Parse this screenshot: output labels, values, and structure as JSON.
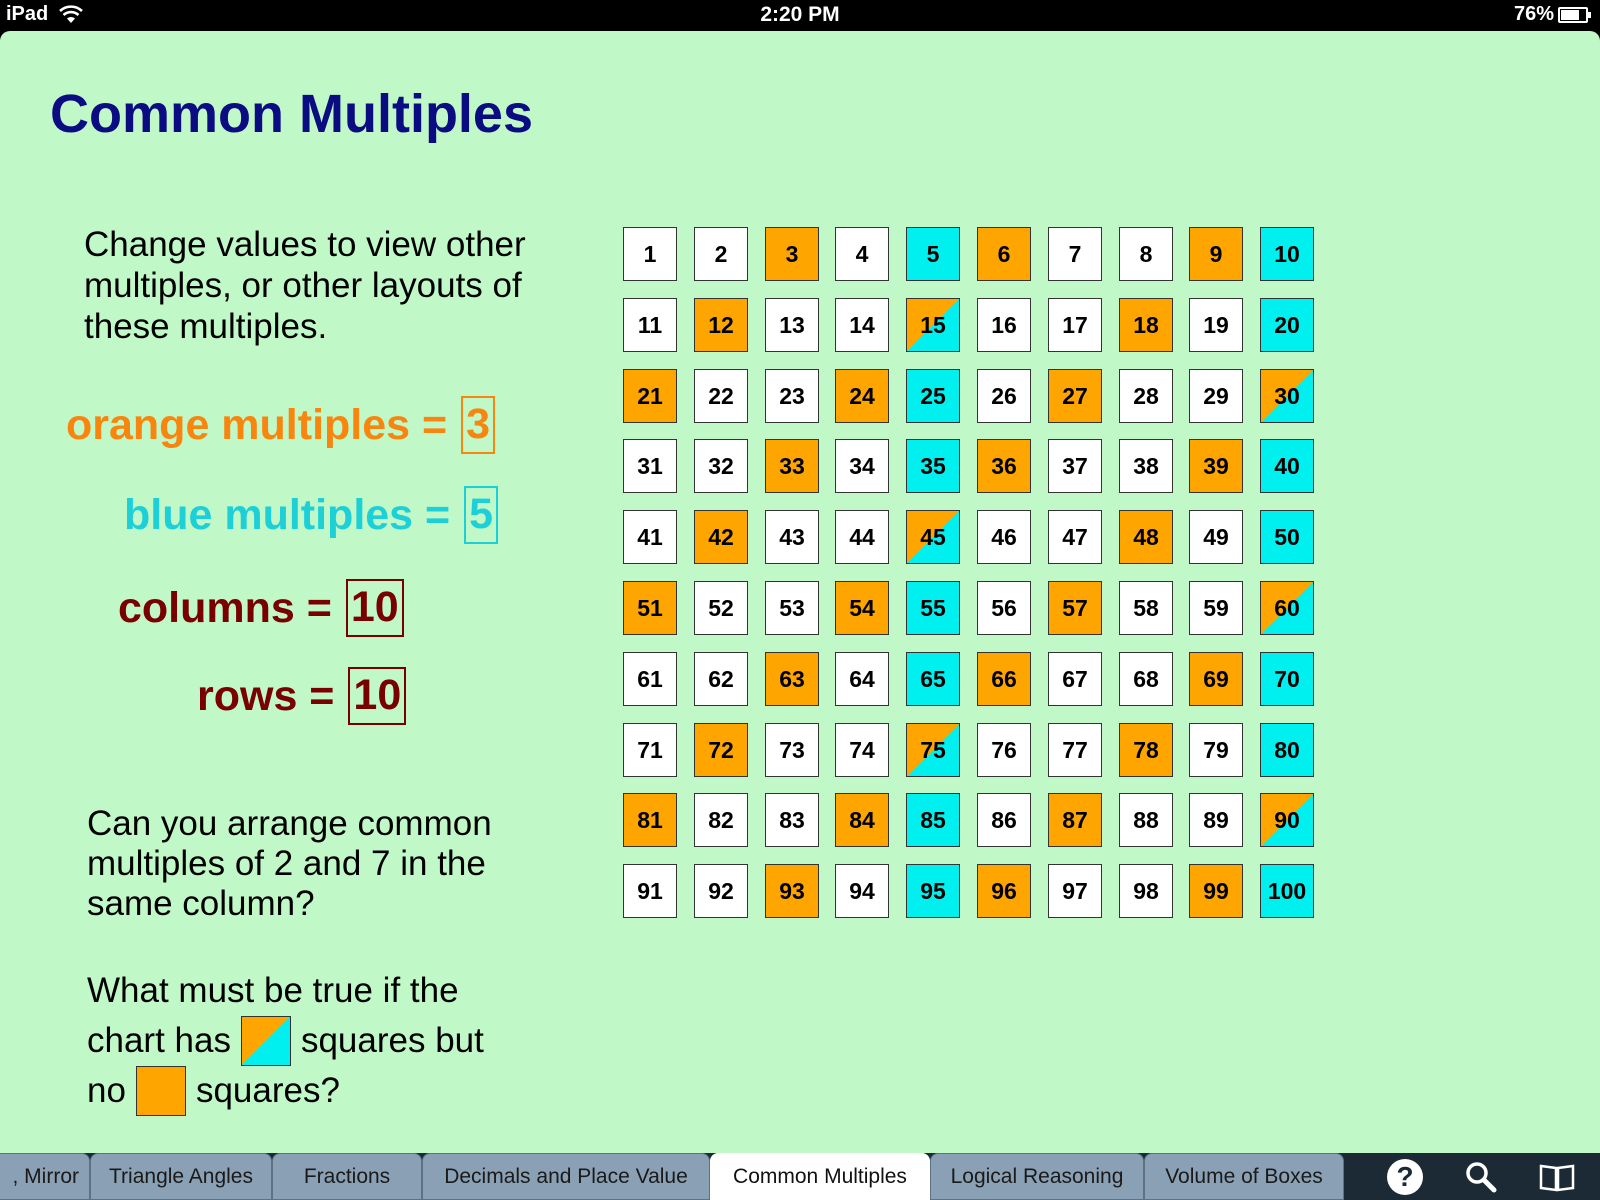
{
  "status_bar": {
    "device": "iPad",
    "time": "2:20 PM",
    "battery": "76%",
    "battery_level": 0.76
  },
  "page": {
    "title": "Common Multiples",
    "intro": "Change values to view other multiples, or other layouts of these multiples.",
    "params": {
      "orange_label": "orange multiples =",
      "orange_value": "3",
      "blue_label": "blue multiples =",
      "blue_value": "5",
      "columns_label": "columns =",
      "columns_value": "10",
      "rows_label": "rows =",
      "rows_value": "10"
    },
    "question1": "Can you arrange common multiples of 2 and 7 in the same column?",
    "question2": {
      "part1": "What must be true if the",
      "part2a": "chart has",
      "part2b": "squares but",
      "part3a": "no",
      "part3b": "squares?"
    }
  },
  "grid": {
    "columns": 10,
    "rows": 10,
    "orange_multiple": 3,
    "blue_multiple": 5,
    "colors": {
      "orange": "#ffa500",
      "blue": "#00f0f0",
      "plain": "#ffffff"
    }
  },
  "tabs": [
    {
      "label": ", Mirror",
      "active": false
    },
    {
      "label": "Triangle Angles",
      "active": false
    },
    {
      "label": "Fractions",
      "active": false
    },
    {
      "label": "Decimals and Place Value",
      "active": false
    },
    {
      "label": "Common Multiples",
      "active": true
    },
    {
      "label": "Logical Reasoning",
      "active": false
    },
    {
      "label": "Volume of Boxes",
      "active": false
    }
  ],
  "toolbar_icons": [
    "help-icon",
    "search-icon",
    "book-icon"
  ]
}
